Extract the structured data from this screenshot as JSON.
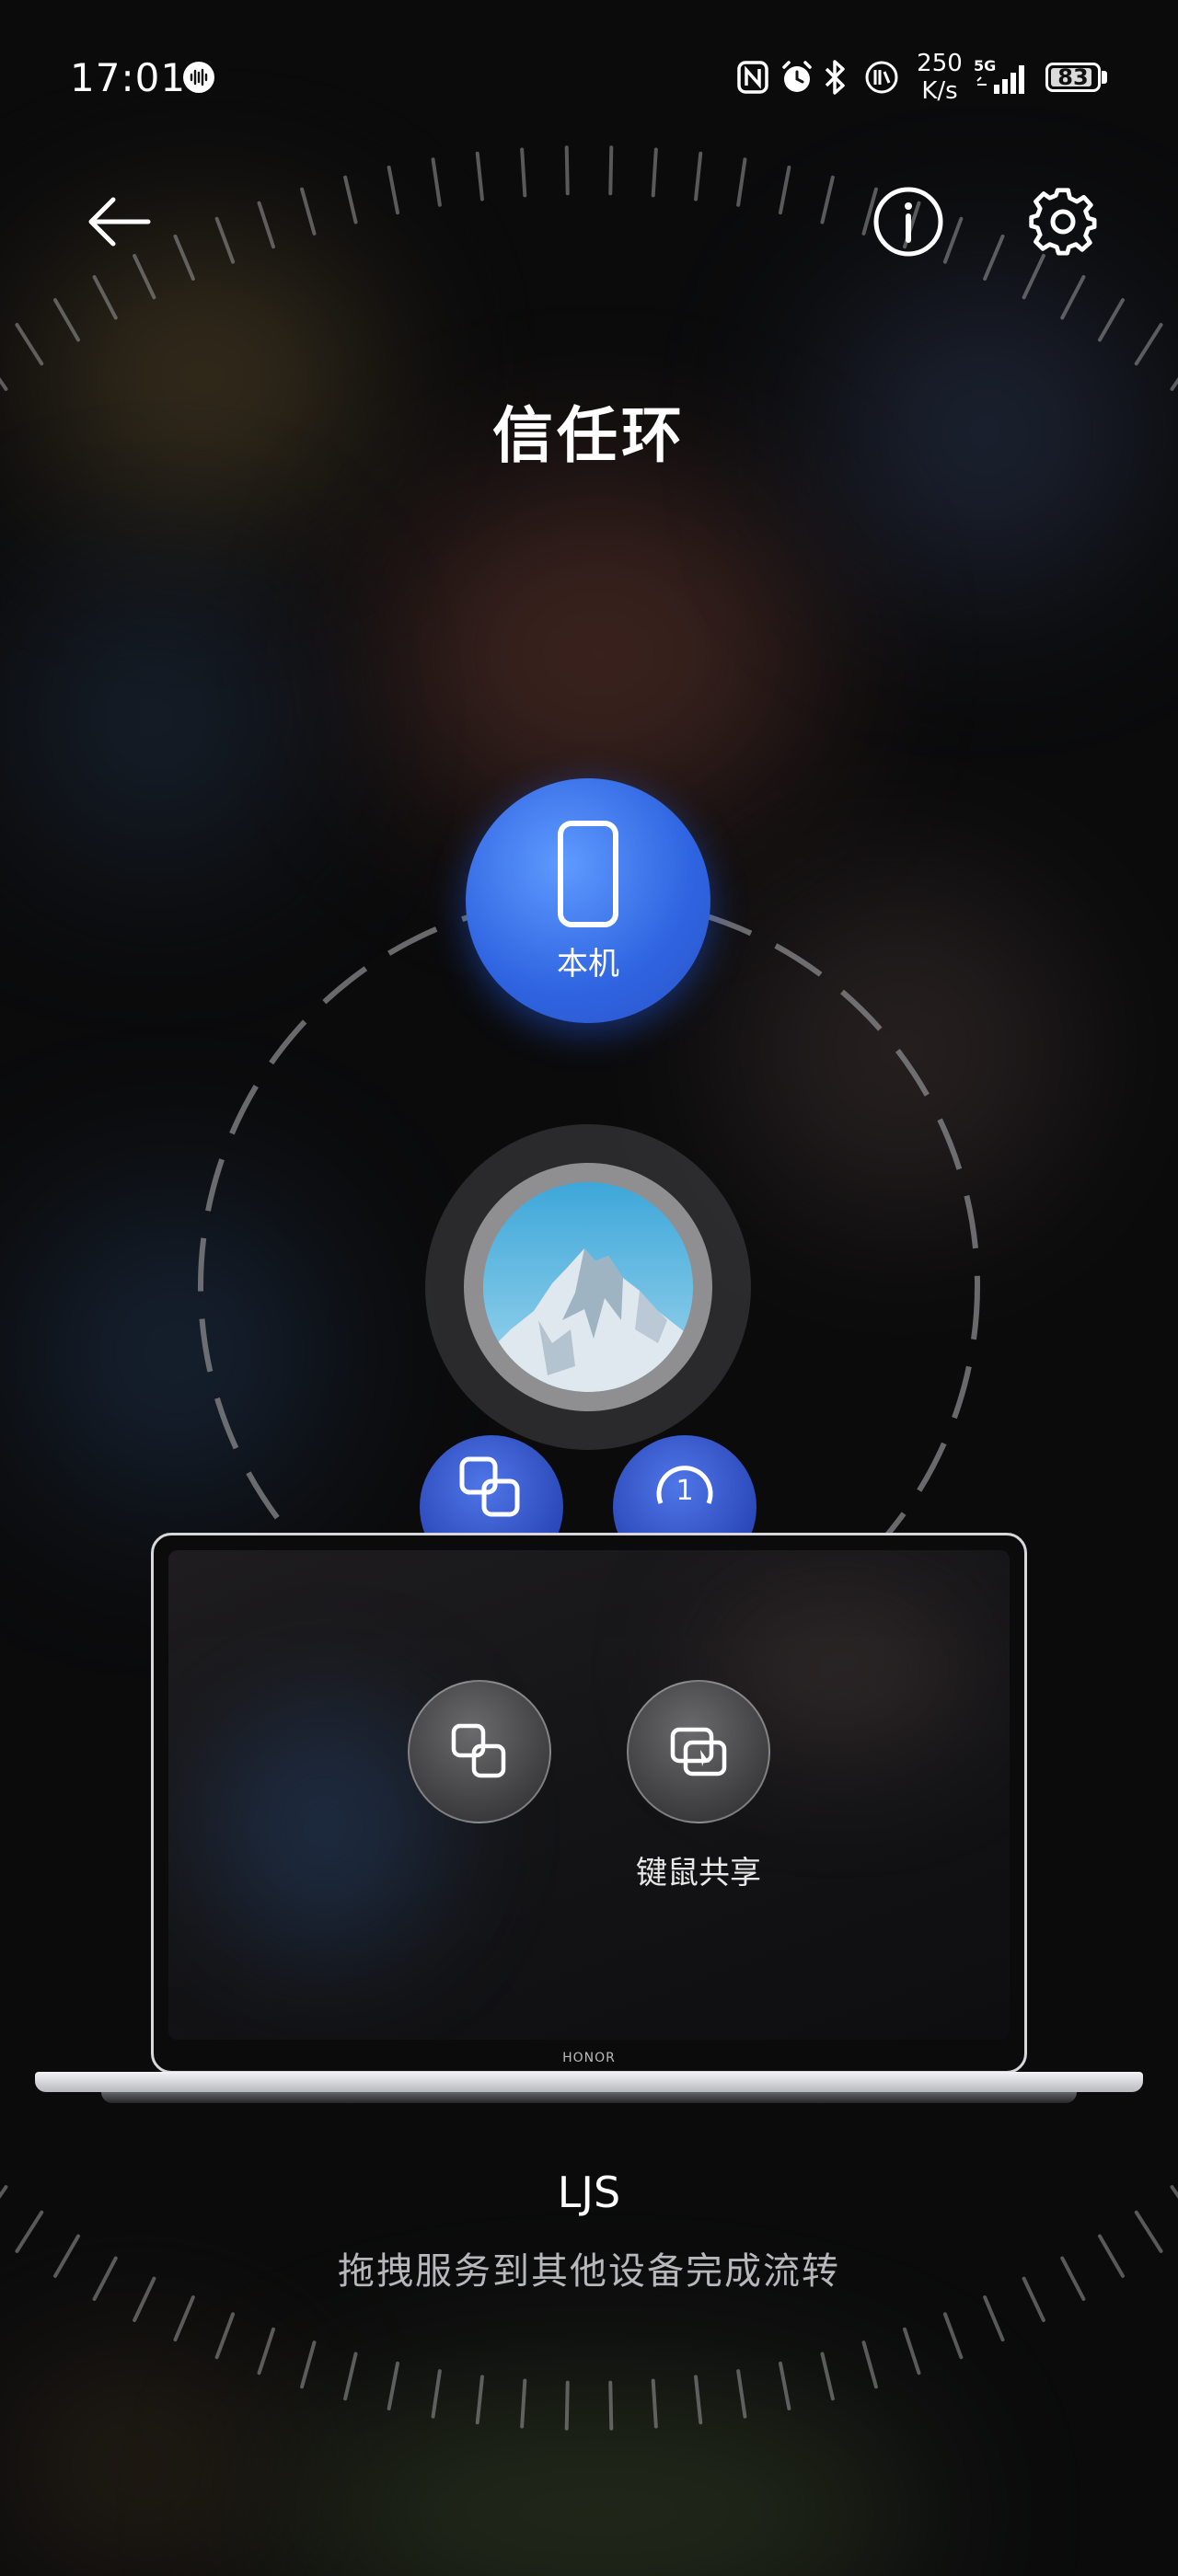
{
  "status_bar": {
    "time": "17:01",
    "net_speed_value": "250",
    "net_speed_unit": "K/s",
    "network_label": "5G",
    "battery_level": "83"
  },
  "page": {
    "title": "信任环"
  },
  "devices": {
    "this_device_label": "本机",
    "connected_device_name": "LJS",
    "laptop_brand": "HONOR"
  },
  "laptop_services": [
    {
      "label": "",
      "icon": "app-relay-icon"
    },
    {
      "label": "键鼠共享",
      "icon": "keyboard-mouse-share-icon"
    }
  ],
  "hint": "拖拽服务到其他设备完成流转",
  "icons": {
    "back": "back-arrow-icon",
    "info": "info-icon",
    "settings": "gear-icon"
  },
  "colors": {
    "accent_blue": "#2f63e0",
    "background": "#0b0b0c"
  }
}
